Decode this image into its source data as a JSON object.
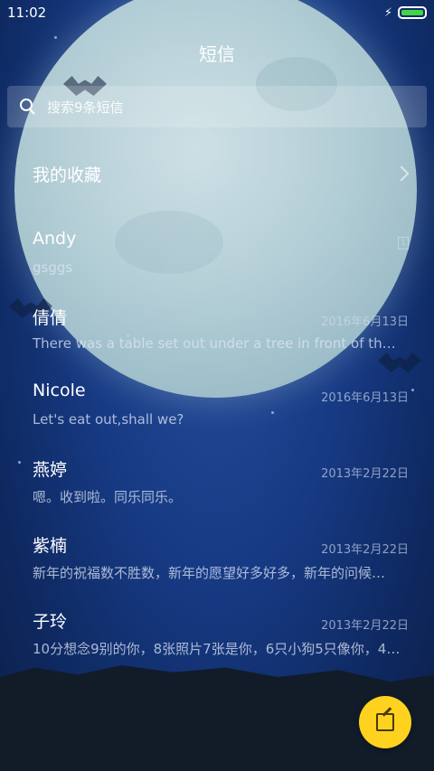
{
  "status_bar": {
    "time": "11:02",
    "battery_level": 1.0,
    "charging_icon": "bolt-icon"
  },
  "header": {
    "title": "短信"
  },
  "search": {
    "placeholder": "搜索9条短信",
    "icon": "search-icon"
  },
  "favorites": {
    "label": "我的收藏",
    "icon": "chevron-right-icon"
  },
  "conversations": [
    {
      "name": "Andy",
      "time": "",
      "preview": "gsggs",
      "sim_badge": "1"
    },
    {
      "name": "倩倩",
      "time": "2016年6月13日",
      "preview": "There was a table set out under a tree in front of the ho…"
    },
    {
      "name": "Nicole",
      "time": "2016年6月13日",
      "preview": "Let's eat out,shall we?"
    },
    {
      "name": "燕婷",
      "time": "2013年2月22日",
      "preview": "嗯。收到啦。同乐同乐。"
    },
    {
      "name": "紫楠",
      "time": "2013年2月22日",
      "preview": "新年的祝福数不胜数，新年的愿望好多好多，新年的问候…"
    },
    {
      "name": "子玲",
      "time": "2013年2月22日",
      "preview": "10分想念9别的你，8张照片7张是你，6只小狗5只像你，4…"
    }
  ],
  "fab": {
    "icon": "compose-icon"
  },
  "colors": {
    "accent": "#ffd21f",
    "battery": "#44d448"
  }
}
